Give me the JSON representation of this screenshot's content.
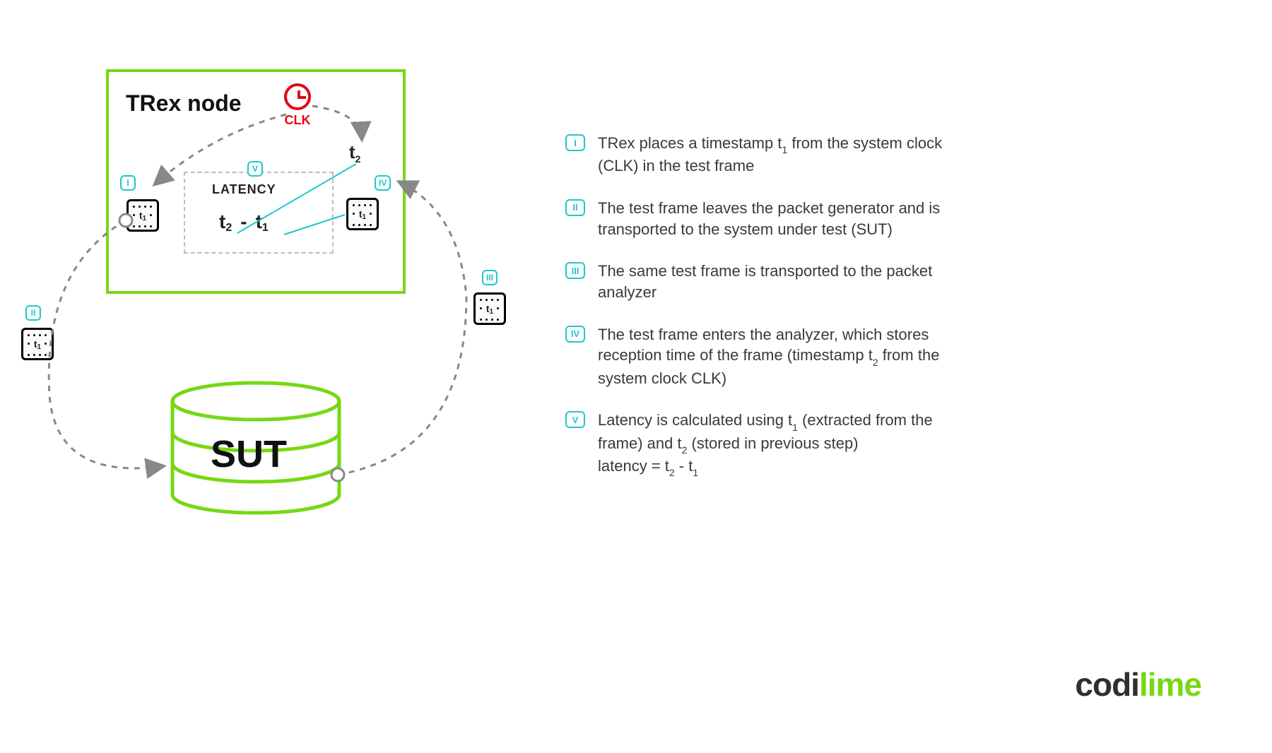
{
  "diagram": {
    "trex_title": "TRex node",
    "clk_label": "CLK",
    "latency_title": "LATENCY",
    "latency_t2": "t",
    "latency_t2_sub": "2",
    "latency_minus": "-",
    "latency_t1": "t",
    "latency_t1_sub": "1",
    "t2_label": "t",
    "t2_sub": "2",
    "frame_t1": "t",
    "frame_t1_sub": "1",
    "sut_label": "SUT",
    "badges": {
      "I": "I",
      "II": "II",
      "III": "III",
      "IV": "IV",
      "V": "V"
    }
  },
  "steps": [
    {
      "num": "I",
      "html": "TRex places a timestamp t<sub>1</sub> from the system clock (CLK) in the test frame"
    },
    {
      "num": "II",
      "html": "The test frame leaves the packet generator and is transported to the system under test (SUT)"
    },
    {
      "num": "III",
      "html": "The same test frame is transported to the packet analyzer"
    },
    {
      "num": "IV",
      "html": "The test frame enters the analyzer, which stores reception time of the frame (timestamp t<sub>2</sub> from the system clock CLK)"
    },
    {
      "num": "V",
      "html": "Latency is calculated using t<sub>1</sub> (extracted from the frame) and t<sub>2</sub> (stored in previous step)<br>latency = t<sub>2</sub> - t<sub>1</sub>"
    }
  ],
  "logo": {
    "left": "codi",
    "right": "lime"
  }
}
